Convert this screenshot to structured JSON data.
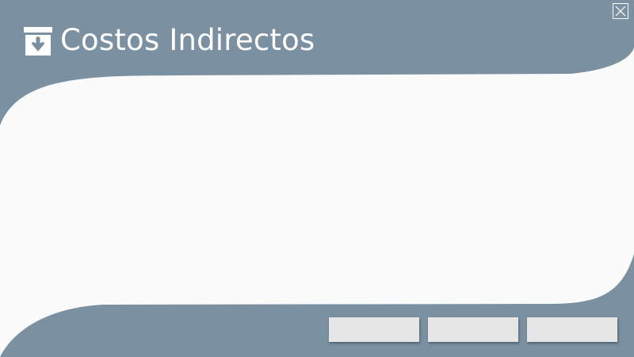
{
  "window": {
    "title": "Costos Indirectos",
    "title_icon": "archive-download-icon",
    "close_icon": "close-icon"
  },
  "colors": {
    "header_background": "#7b91a1",
    "content_background": "#fafafa",
    "button_background": "#e6e6e6",
    "title_text": "#ffffff"
  },
  "footer": {
    "buttons": [
      {
        "label": ""
      },
      {
        "label": ""
      },
      {
        "label": ""
      }
    ]
  }
}
